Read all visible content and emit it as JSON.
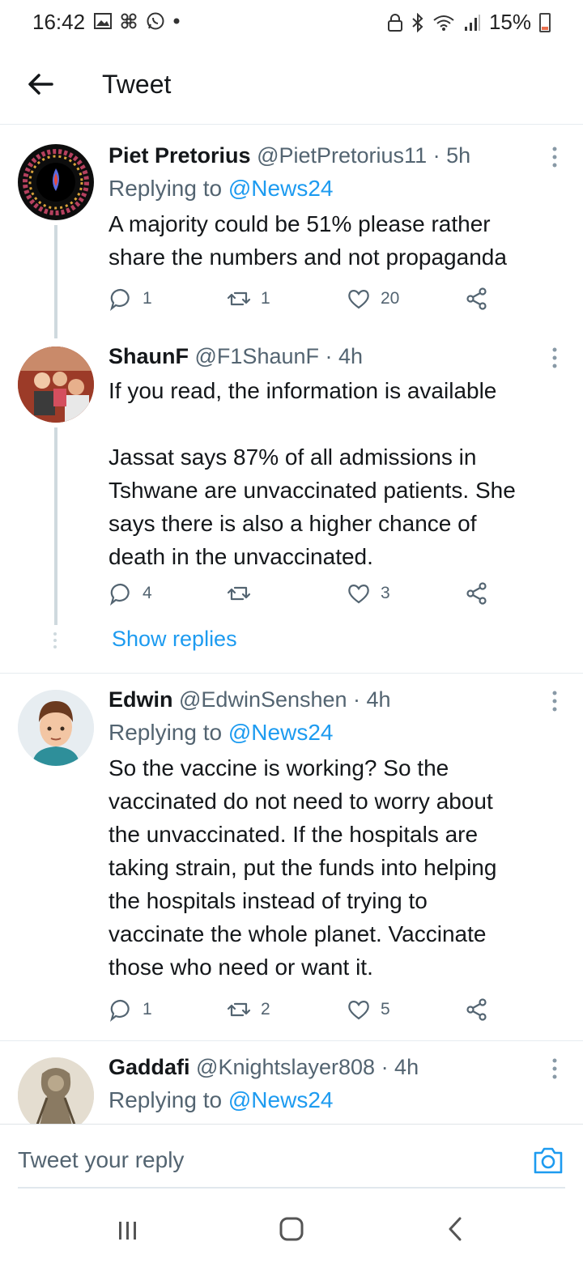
{
  "status_bar": {
    "time": "16:42",
    "battery": "15%"
  },
  "header": {
    "title": "Tweet"
  },
  "tweets": [
    {
      "name": "Piet Pretorius",
      "meta": "@PietPretorius11 · 5h",
      "reply_prefix": "Replying to",
      "reply_to": "@News24",
      "text": "A majority could be 51% please rather\nshare the numbers and not propaganda",
      "replies": "1",
      "retweets": "1",
      "likes": "20"
    },
    {
      "name": "ShaunF",
      "meta": "@F1ShaunF · 4h",
      "text": "If you read, the information is available\n\nJassat says 87% of all admissions in\nTshwane are unvaccinated patients. She\nsays there is also a higher chance of\ndeath in the unvaccinated.",
      "replies": "4",
      "retweets": "",
      "likes": "3",
      "show_replies": "Show replies"
    },
    {
      "name": "Edwin",
      "meta": "@EdwinSenshen · 4h",
      "reply_prefix": "Replying to",
      "reply_to": "@News24",
      "text": "So the vaccine is working? So the\nvaccinated do not need to worry about\nthe unvaccinated. If the hospitals are\ntaking strain, put the funds into helping\nthe hospitals instead of trying to\nvaccinate the whole planet. Vaccinate\nthose who need or want it.",
      "replies": "1",
      "retweets": "2",
      "likes": "5"
    },
    {
      "name": "Gaddafi",
      "meta": "@Knightslayer808 · 4h",
      "reply_prefix": "Replying to",
      "reply_to": "@News24"
    }
  ],
  "reply_bar": {
    "placeholder": "Tweet your reply"
  },
  "colors": {
    "accent": "#1d9bf0",
    "muted": "#536471",
    "text": "#14171a"
  }
}
